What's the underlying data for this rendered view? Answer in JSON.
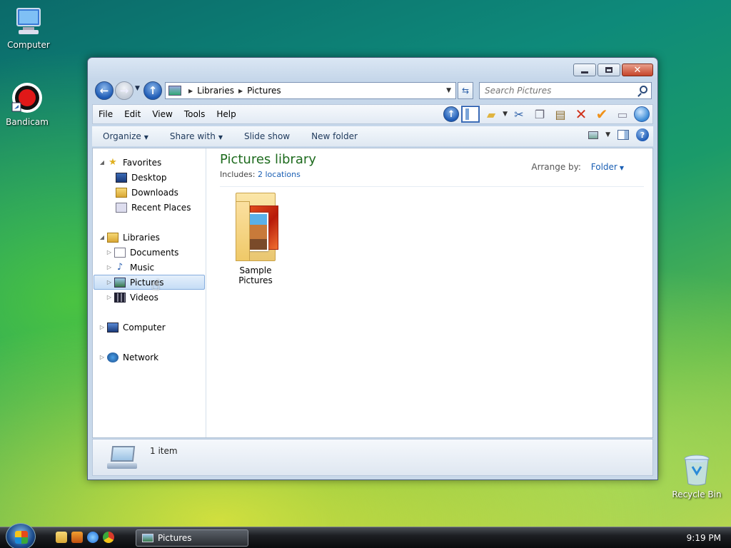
{
  "desktop": {
    "icons": [
      {
        "label": "Computer"
      },
      {
        "label": "Bandicam"
      },
      {
        "label": "Recycle Bin"
      }
    ]
  },
  "window": {
    "address": {
      "crumbs": [
        "Libraries",
        "Pictures"
      ]
    },
    "search": {
      "placeholder": "Search Pictures"
    },
    "menu": [
      "File",
      "Edit",
      "View",
      "Tools",
      "Help"
    ],
    "toolbar_icons": [
      "up-icon",
      "pane-icon",
      "folder-check-icon",
      "scissors-icon",
      "copy-icon",
      "paste-icon",
      "delete-icon",
      "check-icon",
      "properties-icon",
      "globe-icon"
    ],
    "commands": {
      "organize": "Organize",
      "share_with": "Share with",
      "slide_show": "Slide show",
      "new_folder": "New folder"
    },
    "navpane": {
      "favorites": "Favorites",
      "desktop": "Desktop",
      "downloads": "Downloads",
      "recent_places": "Recent Places",
      "libraries": "Libraries",
      "documents": "Documents",
      "music": "Music",
      "pictures": "Pictures",
      "videos": "Videos",
      "computer": "Computer",
      "network": "Network"
    },
    "main": {
      "title": "Pictures library",
      "includes_label": "Includes:",
      "includes_link": "2 locations",
      "arrange_label": "Arrange by:",
      "arrange_value": "Folder",
      "items": [
        {
          "label": "Sample Pictures"
        }
      ]
    },
    "details": {
      "text": "1 item"
    }
  },
  "taskbar": {
    "task_label": "Pictures",
    "clock": "9:19 PM"
  },
  "colors": {
    "title_green": "#1e6b1e",
    "link_blue": "#1a5fb4"
  }
}
